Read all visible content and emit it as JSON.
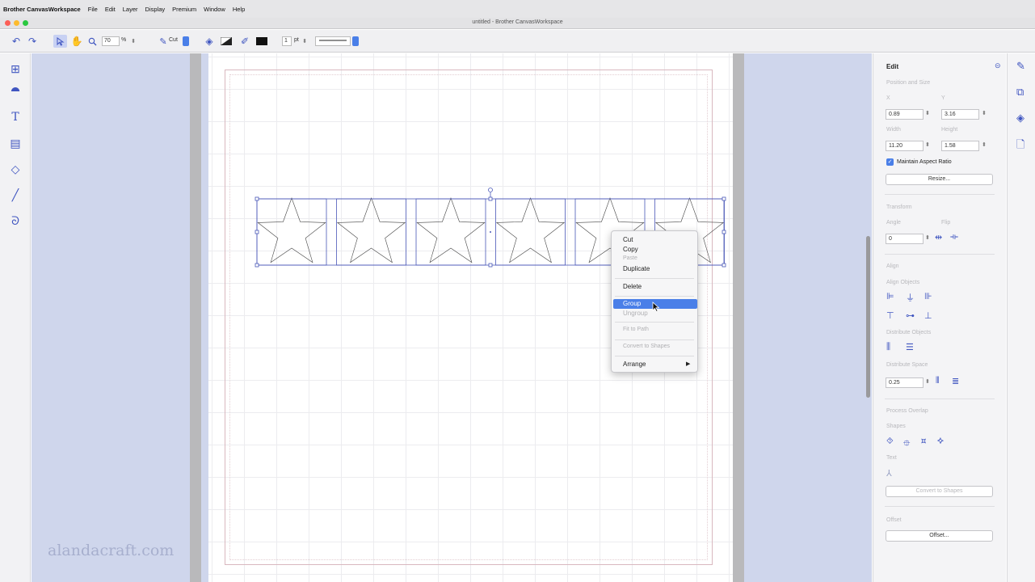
{
  "menubar": {
    "app_name": "Brother CanvasWorkspace",
    "items": [
      "File",
      "Edit",
      "Layer",
      "Display",
      "Premium",
      "Window",
      "Help"
    ]
  },
  "window": {
    "title": "untitled - Brother CanvasWorkspace",
    "traffic_lights": [
      "#fc5f57",
      "#fdbb2e",
      "#2ac840"
    ]
  },
  "toolbar": {
    "zoom_value": "70",
    "zoom_unit": "%",
    "mode_label": "Cut",
    "line_width": "1",
    "line_unit": "pt"
  },
  "left_tools": [
    "import-icon",
    "shapes-icon",
    "text-icon",
    "pattern-icon",
    "fill-icon",
    "line-icon",
    "curve-icon"
  ],
  "watermark": "alandacraft.com",
  "context_menu": {
    "items": [
      {
        "label": "Cut",
        "enabled": true
      },
      {
        "label": "Copy",
        "enabled": true
      },
      {
        "label": "Paste",
        "enabled": false
      },
      {
        "label": "Duplicate",
        "enabled": true
      },
      {
        "label": "Delete",
        "enabled": true
      },
      {
        "label": "Group",
        "enabled": true,
        "highlighted": true
      },
      {
        "label": "Ungroup",
        "enabled": false
      },
      {
        "label": "Fit to Path",
        "enabled": false
      },
      {
        "label": "Convert to Shapes",
        "enabled": false
      },
      {
        "label": "Arrange",
        "enabled": true,
        "submenu_arrow": "▶"
      }
    ]
  },
  "edit_panel": {
    "title": "Edit",
    "position_size": {
      "heading": "Position and Size",
      "x_label": "X",
      "y_label": "Y",
      "x_value": "0.89",
      "y_value": "3.16",
      "width_label": "Width",
      "height_label": "Height",
      "width_value": "11.20",
      "height_value": "1.58",
      "maintain_aspect": "Maintain Aspect Ratio",
      "resize_button": "Resize..."
    },
    "transform": {
      "heading": "Transform",
      "angle_label": "Angle",
      "flip_label": "Flip",
      "angle_value": "0"
    },
    "align": {
      "heading": "Align",
      "align_objects": "Align Objects",
      "distribute_objects": "Distribute Objects",
      "distribute_space": "Distribute Space",
      "space_value": "0.25"
    },
    "process_overlap": {
      "heading": "Process Overlap",
      "shapes_label": "Shapes",
      "text_label": "Text",
      "convert_button": "Convert to Shapes"
    },
    "offset": {
      "heading": "Offset",
      "offset_button": "Offset..."
    }
  },
  "colors": {
    "accent": "#3f55c0",
    "workspace_bg": "#cfd6ec",
    "highlight": "#4a7fe8",
    "selection_line": "#4a58b8"
  }
}
